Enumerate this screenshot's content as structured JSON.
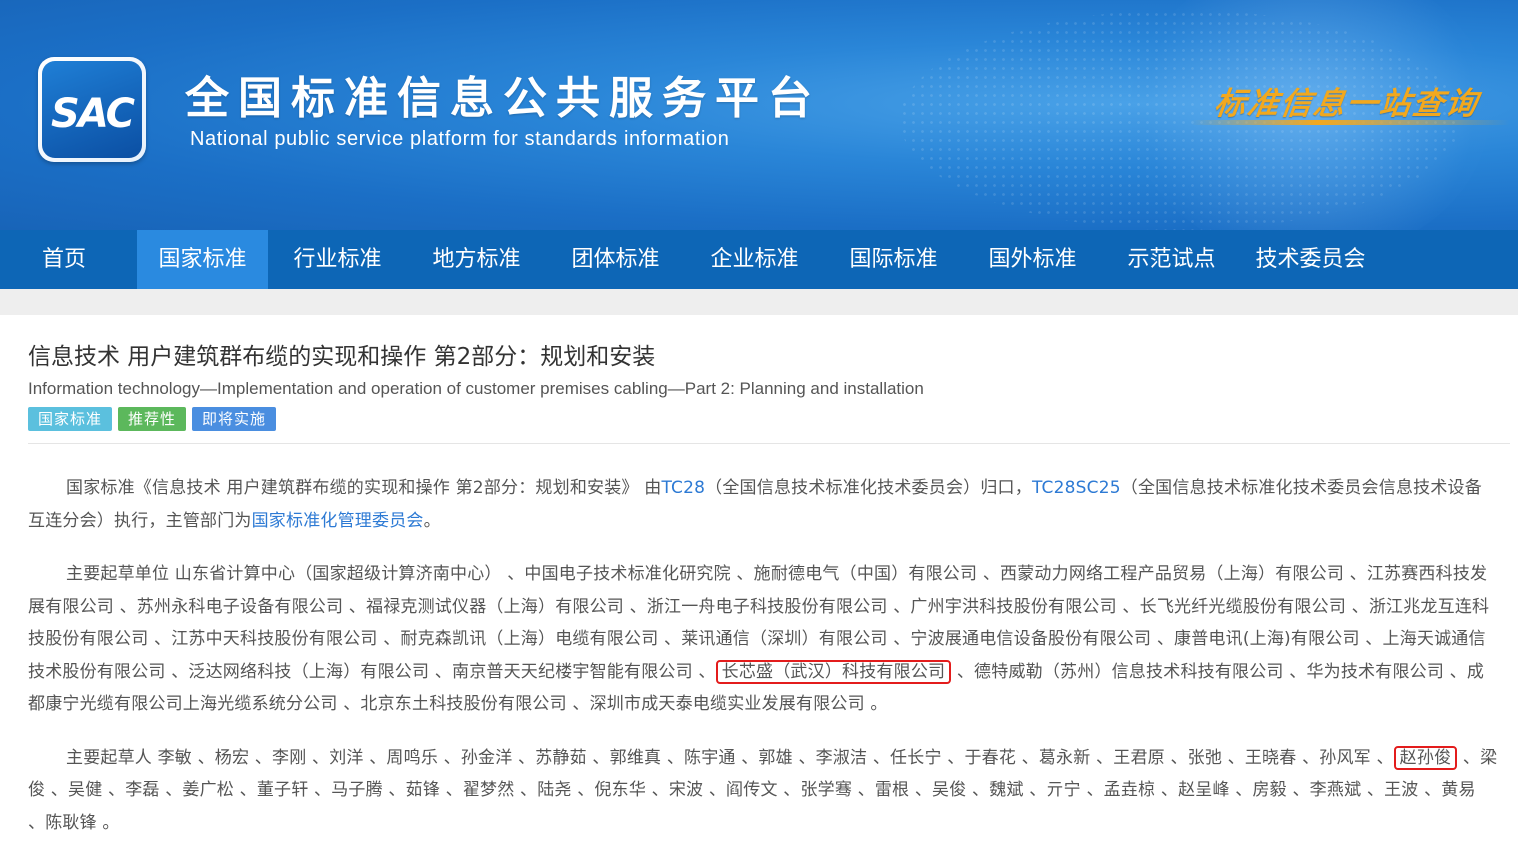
{
  "header": {
    "logo_text": "SAC",
    "title": "全国标准信息公共服务平台",
    "subtitle": "National public service platform  for standards information",
    "slogan": "标准信息一站查询"
  },
  "nav": {
    "items": [
      {
        "label": "首页"
      },
      {
        "label": "国家标准",
        "active": true
      },
      {
        "label": "行业标准"
      },
      {
        "label": "地方标准"
      },
      {
        "label": "团体标准"
      },
      {
        "label": "企业标准"
      },
      {
        "label": "国际标准"
      },
      {
        "label": "国外标准"
      },
      {
        "label": "示范试点"
      },
      {
        "label": "技术委员会"
      }
    ]
  },
  "standard": {
    "title_cn": "信息技术 用户建筑群布缆的实现和操作 第2部分：规划和安装",
    "title_en": "Information technology—Implementation and operation of customer premises cabling—Part 2: Planning and installation",
    "tags": [
      "国家标准",
      "推荐性",
      "即将实施"
    ]
  },
  "intro": {
    "prefix": "国家标准《信息技术 用户建筑群布缆的实现和操作 第2部分：规划和安装》 由",
    "tc_link": "TC28",
    "tc_desc": "（全国信息技术标准化技术委员会）归口，",
    "sc_link": "TC28SC25",
    "sc_desc": "（全国信息技术标准化技术委员会信息技术设备互连分会）执行，主管部门为",
    "dept_link": "国家标准化管理委员会",
    "suffix": "。"
  },
  "drafting_units": {
    "label": "主要起草单位",
    "before": " 山东省计算中心（国家超级计算济南中心） 、中国电子技术标准化研究院 、施耐德电气（中国）有限公司 、西蒙动力网络工程产品贸易（上海）有限公司 、江苏赛西科技发展有限公司 、苏州永科电子设备有限公司 、福禄克测试仪器（上海）有限公司 、浙江一舟电子科技股份有限公司 、广州宇洪科技股份有限公司 、长飞光纤光缆股份有限公司 、浙江兆龙互连科技股份有限公司 、江苏中天科技股份有限公司 、耐克森凯讯（上海）电缆有限公司 、莱讯通信（深圳）有限公司 、宁波展通电信设备股份有限公司 、康普电讯(上海)有限公司 、上海天诚通信技术股份有限公司 、泛达网络科技（上海）有限公司 、南京普天天纪楼宇智能有限公司 、",
    "highlighted": "长芯盛（武汉）科技有限公司",
    "after": " 、德特威勒（苏州）信息技术科技有限公司 、华为技术有限公司 、成都康宁光缆有限公司上海光缆系统分公司 、北京东土科技股份有限公司 、深圳市成天泰电缆实业发展有限公司 。"
  },
  "drafters": {
    "label": "主要起草人",
    "before": " 李敏 、杨宏 、李刚 、刘洋 、周鸣乐 、孙金洋 、苏静茹 、郭维真 、陈宇通 、郭雄 、李淑洁 、任长宁 、于春花 、葛永新 、王君原 、张弛 、王晓春 、孙风军 、",
    "highlighted": "赵孙俊",
    "after": " 、梁俊 、吴健 、李磊 、姜广松 、董子轩 、马子腾 、茹锋 、翟梦然 、陆尧 、倪东华 、宋波 、阎传文 、张学骞 、雷根 、吴俊 、魏斌 、亓宁 、孟垚椋 、赵呈峰 、房毅 、李燕斌 、王波 、黄易 、陈耿锋 。"
  },
  "colors": {
    "banner": "#1b6fc6",
    "nav": "#0d66b6",
    "nav_active": "#2a8ae0",
    "link": "#2d7ad4",
    "highlight_box": "#e31c1c",
    "tag_national": "#5bc0de",
    "tag_recommended": "#5cb85c",
    "tag_upcoming": "#4a8ee0"
  }
}
